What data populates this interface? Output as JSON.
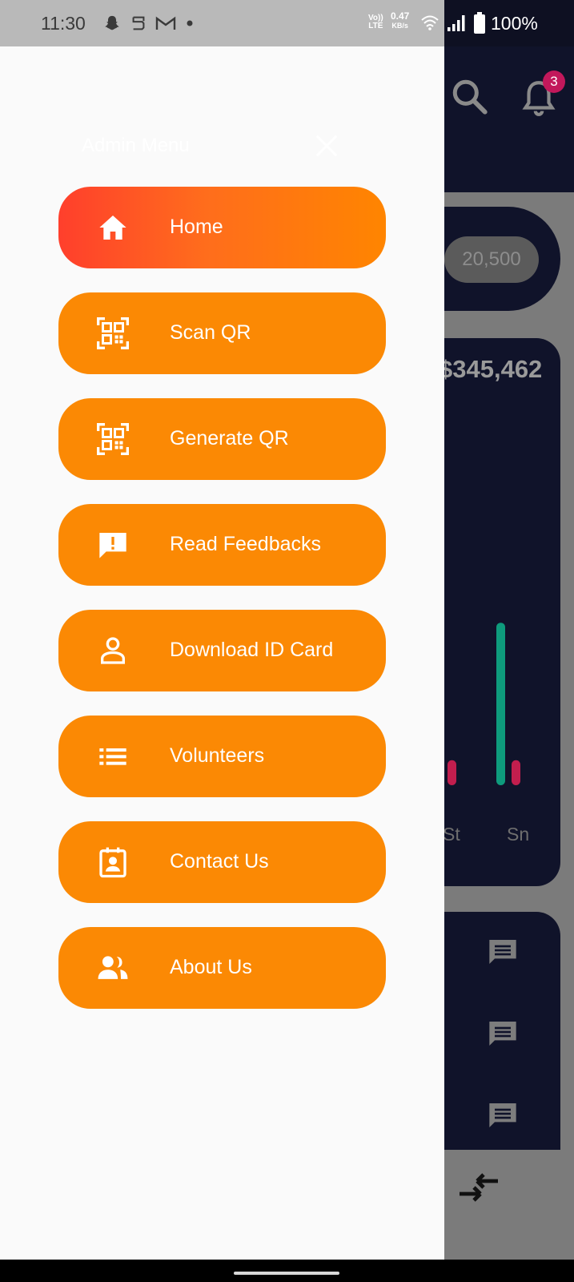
{
  "status_bar": {
    "time": "11:30",
    "net_speed_value": "0.47",
    "net_speed_unit": "KB/s",
    "volte_top": "Vo))",
    "volte_bottom": "LTE",
    "battery": "100%",
    "icons": [
      "snapchat-icon",
      "sync-icon",
      "gmail-icon",
      "dot-icon",
      "wifi-icon",
      "signal-icon",
      "battery-icon"
    ]
  },
  "background": {
    "notification_count": "3",
    "balance": "20,500",
    "chart_total": "$345,462",
    "x_labels": [
      "St",
      "Sn"
    ],
    "icons": [
      "search-icon",
      "bell-icon",
      "message-icon",
      "swap-icon"
    ]
  },
  "chart_data": {
    "type": "bar",
    "categories": [
      "St",
      "Sn"
    ],
    "series": [
      {
        "color": "#0e9b7c",
        "values": [
          100,
          52
        ]
      },
      {
        "color": "#c21e4e",
        "values": [
          8,
          8
        ]
      }
    ],
    "ylim": [
      0,
      100
    ],
    "note_visible": false
  },
  "drawer": {
    "title": "Admin Menu",
    "close_icon": "close-icon",
    "items": [
      {
        "label": "Home",
        "icon": "home-icon",
        "active": true
      },
      {
        "label": "Scan QR",
        "icon": "qr-code-icon",
        "active": false
      },
      {
        "label": "Generate QR",
        "icon": "qr-code-icon",
        "active": false
      },
      {
        "label": "Read Feedbacks",
        "icon": "feedback-icon",
        "active": false
      },
      {
        "label": "Download ID Card",
        "icon": "person-icon",
        "active": false
      },
      {
        "label": "Volunteers",
        "icon": "list-icon",
        "active": false
      },
      {
        "label": "Contact Us",
        "icon": "contact-card-icon",
        "active": false
      },
      {
        "label": "About Us",
        "icon": "group-icon",
        "active": false
      }
    ]
  },
  "colors": {
    "menu_orange": "#fb8904",
    "gradient_start": "#ff3f2c",
    "dark_navy": "#10132a",
    "drawer_bg": "#fafafa"
  }
}
